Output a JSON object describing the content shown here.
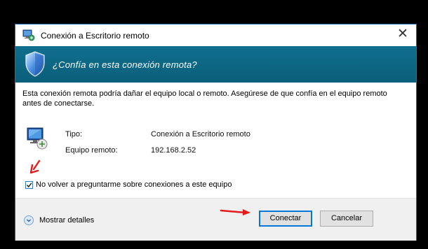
{
  "window": {
    "title": "Conexión a Escritorio remoto",
    "close_glyph": "✕"
  },
  "banner": {
    "question": "¿Confía en esta conexión remota?",
    "color": "#0b6a87"
  },
  "message": "Esta conexión remota podría dañar el equipo local o remoto. Asegúrese de que confía en el equipo remoto antes de conectarse.",
  "details": [
    {
      "label": "Tipo:",
      "value": "Conexión a Escritorio remoto"
    },
    {
      "label": "Equipo remoto:",
      "value": "192.168.2.52"
    }
  ],
  "checkbox": {
    "label": "No volver a preguntarme sobre conexiones a este equipo",
    "checked": true
  },
  "footer": {
    "show_details": "Mostrar detalles",
    "connect": "Conectar",
    "cancel": "Cancelar"
  },
  "annotation_color": "#e21b1b"
}
